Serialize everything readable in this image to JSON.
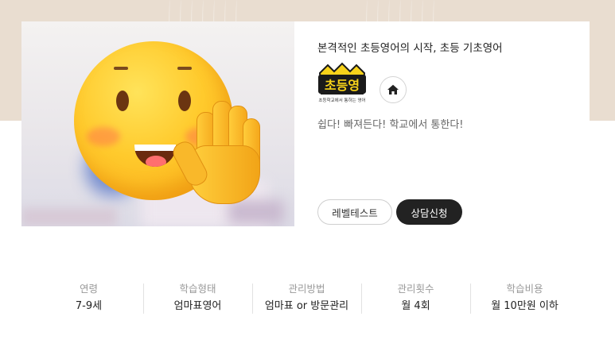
{
  "program": {
    "title": "본격적인 초등영어의 시작, 초등 기초영어",
    "logo_text": "초등영",
    "logo_tagline": "초등학교에서 통하는 영어",
    "slogan": "쉽다! 빠져든다! 학교에서 통한다!",
    "buttons": {
      "level_test": "레벨테스트",
      "consult": "상담신청"
    }
  },
  "info": [
    {
      "label": "연령",
      "value": "7-9세"
    },
    {
      "label": "학습형태",
      "value": "엄마표영어"
    },
    {
      "label": "관리방법",
      "value": "엄마표 or 방문관리"
    },
    {
      "label": "관리횟수",
      "value": "월 4회"
    },
    {
      "label": "학습비용",
      "value": "월 10만원 이하"
    }
  ],
  "colors": {
    "hero_bg": "#e9ddd0",
    "primary_button": "#222222",
    "logo_yellow": "#f7d21a"
  },
  "icons": {
    "home": "home-icon",
    "thumbnail_overlay": "waving-hand-emoji"
  }
}
